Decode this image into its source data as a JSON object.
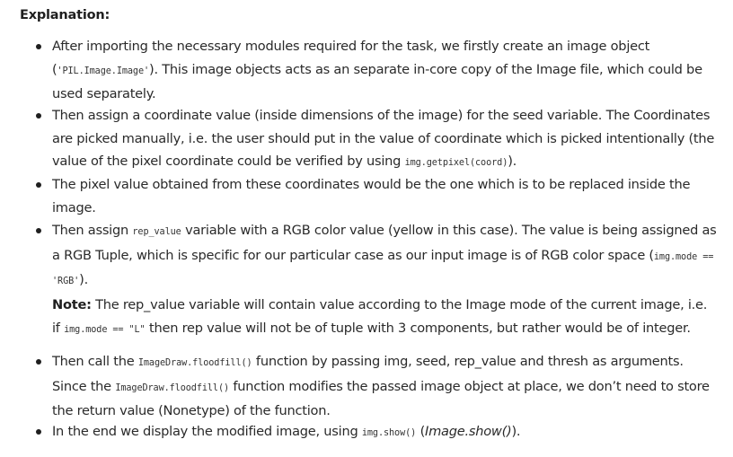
{
  "heading": "Explanation:",
  "items": [
    {
      "t1": "After importing the necessary modules required for the task, we firstly create an image object (",
      "c1": "'PIL.Image.Image'",
      "t2": "). This image objects acts as an separate in-core copy of the Image file, which could be used separately."
    },
    {
      "t1": "Then assign a coordinate value (inside dimensions of the image) for the seed variable. The Coordinates are picked manually, i.e. the user should put in the value of coordinate which is picked intentionally (the value of the pixel coordinate could be verified by using ",
      "c1": "img.getpixel(coord)",
      "t2": ")."
    },
    {
      "t1": "The pixel value obtained from these coordinates would be the one which is to be replaced inside the image."
    },
    {
      "t1": "Then assign ",
      "c1": "rep_value",
      "t2": " variable with a RGB color value (yellow in this case). The value is being assigned as a RGB Tuple, which is specific for our particular case as our input image is of RGB color space (",
      "c2": "img.mode == 'RGB'",
      "t3": ")."
    },
    {
      "t1": "Then call the ",
      "c1": "ImageDraw.floodfill()",
      "t2": " function by passing img, seed, rep_value and thresh as arguments. Since the ",
      "c2": "ImageDraw.floodfill()",
      "t3": "  function modifies the passed image object at place, we don’t need to store the return value (Nonetype) of the function."
    },
    {
      "t1": "In the end we display the modified image, using ",
      "c1": "img.show()",
      "t2": "  (",
      "i1": "Image.show()",
      "t3": ")."
    }
  ],
  "note": {
    "label": "Note:",
    "t1": " The rep_value variable will contain value according to the Image mode of the current image, i.e. if ",
    "c1": "img.mode == \"L\"",
    "t2": " then rep value will not be of tuple with 3 components, but rather would be of integer."
  }
}
